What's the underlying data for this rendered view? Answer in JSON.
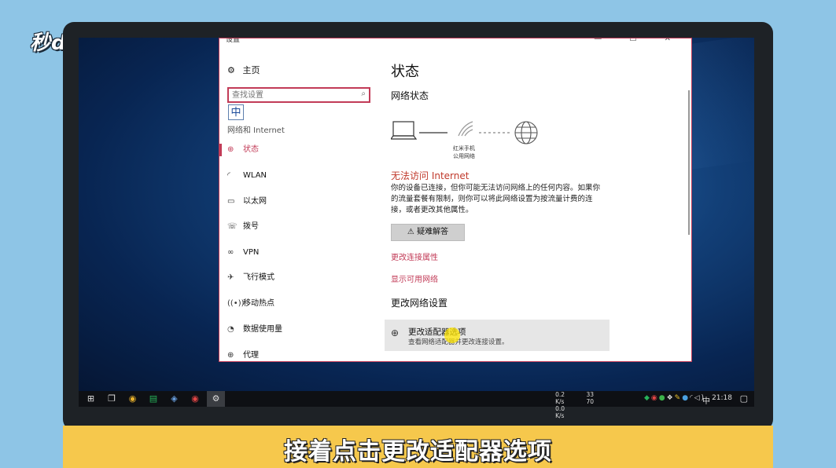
{
  "brand": {
    "logo": "秒dong视频"
  },
  "window": {
    "title": "设置",
    "controls": "—  ☐  ✕"
  },
  "sidebar": {
    "home": "主页",
    "search_placeholder": "查找设置",
    "ime": "中",
    "section": "网络和 Internet",
    "items": [
      {
        "label": "状态",
        "icon": "status-icon"
      },
      {
        "label": "WLAN",
        "icon": "wlan-icon"
      },
      {
        "label": "以太网",
        "icon": "ethernet-icon"
      },
      {
        "label": "拨号",
        "icon": "dialup-icon"
      },
      {
        "label": "VPN",
        "icon": "vpn-icon"
      },
      {
        "label": "飞行模式",
        "icon": "airplane-icon"
      },
      {
        "label": "移动热点",
        "icon": "hotspot-icon"
      },
      {
        "label": "数据使用量",
        "icon": "data-usage-icon"
      },
      {
        "label": "代理",
        "icon": "proxy-icon"
      }
    ]
  },
  "main": {
    "title": "状态",
    "network_status": "网络状态",
    "network_name_line1": "红米手机",
    "network_name_line2": "公用网络",
    "error_title": "无法访问 Internet",
    "error_text": "你的设备已连接，但你可能无法访问网络上的任何内容。如果你的流量套餐有限制，则你可以将此网络设置为按流量计费的连接，或者更改其他属性。",
    "troubleshoot": "疑难解答",
    "link_properties": "更改连接属性",
    "link_networks": "显示可用网络",
    "change_settings": "更改网络设置",
    "adapter_title": "更改适配器选项",
    "adapter_desc": "查看网络适配器并更改连接设置。"
  },
  "taskbar": {
    "net_up": "0.2 K/s",
    "net_down": "0.0 K/s",
    "temp1": "33",
    "temp2": "70",
    "lang": "中",
    "time": "21:18"
  },
  "caption": "接着点击更改适配器选项",
  "colors": {
    "accent": "#c23b57",
    "error": "#c0392b",
    "caption_bg": "#f6c84c"
  }
}
